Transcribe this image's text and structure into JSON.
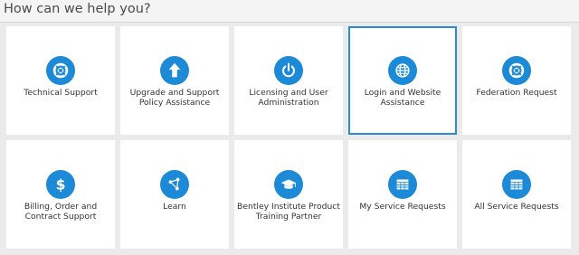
{
  "header": {
    "title": "How can we help you?"
  },
  "theme": {
    "accent": "#1c8ad6",
    "selected_border": "#2b8ad3",
    "tile_bg": "#ffffff",
    "page_bg": "#ebebeb"
  },
  "tiles": [
    {
      "label": "Technical Support",
      "icon": "lifebuoy-icon",
      "selected": false
    },
    {
      "label": "Upgrade and Support Policy Assistance",
      "icon": "arrow-up-icon",
      "selected": false
    },
    {
      "label": "Licensing and User Administration",
      "icon": "power-icon",
      "selected": false
    },
    {
      "label": "Login and Website Assistance",
      "icon": "globe-icon",
      "selected": true
    },
    {
      "label": "Federation Request",
      "icon": "lifebuoy-icon",
      "selected": false
    },
    {
      "label": "Billing, Order and Contract Support",
      "icon": "dollar-icon",
      "selected": false
    },
    {
      "label": "Learn",
      "icon": "network-icon",
      "selected": false
    },
    {
      "label": "Bentley Institute Product Training Partner",
      "icon": "graduation-cap-icon",
      "selected": false
    },
    {
      "label": "My Service Requests",
      "icon": "table-icon",
      "selected": false
    },
    {
      "label": "All Service Requests",
      "icon": "table-icon",
      "selected": false
    }
  ]
}
